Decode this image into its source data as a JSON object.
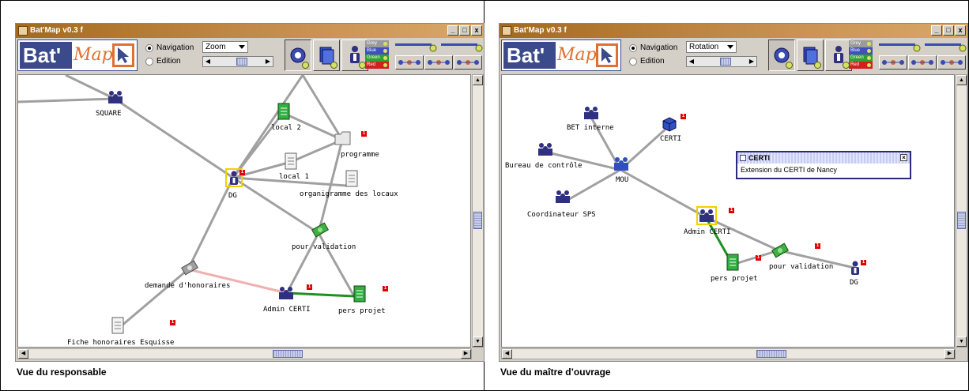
{
  "app": {
    "window_title": "Bat'Map v0.3 f",
    "logo_bat": "Bat'",
    "logo_map": "Map.",
    "window_buttons": [
      "_",
      "□",
      "x"
    ],
    "mode_navigation": "Navigation",
    "mode_edition": "Edition",
    "color_filters": [
      {
        "label": "Grey",
        "color": "#9a9a9a"
      },
      {
        "label": "Blue",
        "color": "#4050c0"
      },
      {
        "label": "Green",
        "color": "#30a030"
      },
      {
        "label": "Red",
        "color": "#d02020"
      }
    ]
  },
  "left": {
    "caption": "Vue du responsable",
    "tool_select": "Zoom",
    "nodes": [
      {
        "id": "square",
        "label": "SQUARE",
        "icon": "group-icon"
      },
      {
        "id": "local2",
        "label": "local 2",
        "icon": "document-green-icon"
      },
      {
        "id": "programme",
        "label": "programme",
        "icon": "folder-icon",
        "badge": "1"
      },
      {
        "id": "local1",
        "label": "local 1",
        "icon": "document-icon"
      },
      {
        "id": "dg",
        "label": "DG",
        "icon": "person-icon",
        "badge": "1"
      },
      {
        "id": "organigramme",
        "label": "organigramme des locaux",
        "icon": "document-icon"
      },
      {
        "id": "validation",
        "label": "pour validation",
        "icon": "money-icon"
      },
      {
        "id": "honoraires",
        "label": "demande d'honoraires",
        "icon": "money-grey-icon"
      },
      {
        "id": "admin",
        "label": "Admin CERTI",
        "icon": "group-icon",
        "badge": "1"
      },
      {
        "id": "persprojet",
        "label": "pers projet",
        "icon": "document-green-icon",
        "badge": "1"
      },
      {
        "id": "fiche",
        "label": "Fiche honoraires Esquisse",
        "icon": "document-icon",
        "badge": "1"
      }
    ]
  },
  "right": {
    "caption": "Vue du maître d’ouvrage",
    "tool_select": "Rotation",
    "popup": {
      "title": "CERTI",
      "text": "Extension du CERTI de Nancy"
    },
    "nodes": [
      {
        "id": "bet",
        "label": "BET interne",
        "icon": "group-icon"
      },
      {
        "id": "certi",
        "label": "CERTI",
        "icon": "cube-icon",
        "badge": "1"
      },
      {
        "id": "bureau",
        "label": "Bureau de contrôle",
        "icon": "group-icon"
      },
      {
        "id": "mou",
        "label": "MOU",
        "icon": "group-blue-icon"
      },
      {
        "id": "coord",
        "label": "Coordinateur SPS",
        "icon": "group-icon"
      },
      {
        "id": "admin",
        "label": "Admin CERTI",
        "icon": "group-icon",
        "badge": "1"
      },
      {
        "id": "persprojet",
        "label": "pers projet",
        "icon": "document-green-icon",
        "badge": "1"
      },
      {
        "id": "validation",
        "label": "pour validation",
        "icon": "money-icon",
        "badge": "1"
      },
      {
        "id": "dg",
        "label": "DG",
        "icon": "person-icon",
        "badge": "1"
      }
    ]
  }
}
